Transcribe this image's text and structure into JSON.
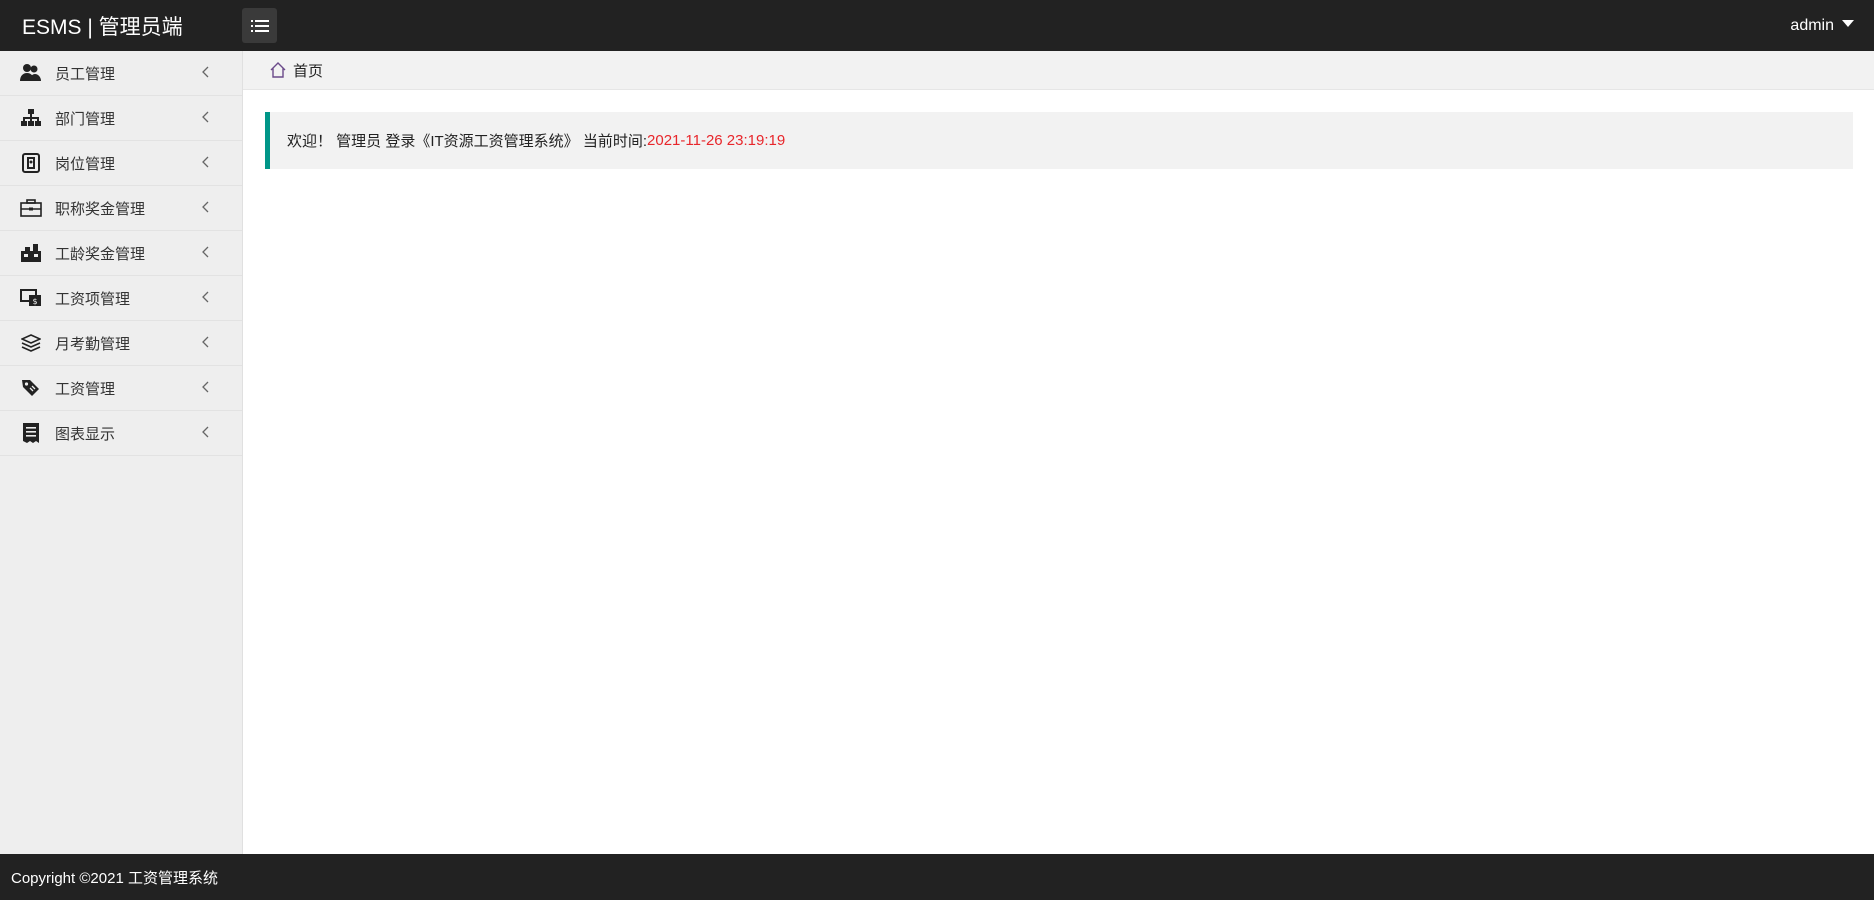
{
  "header": {
    "brand": "ESMS | 管理员端",
    "user": "admin"
  },
  "sidebar": {
    "items": [
      {
        "label": "员工管理",
        "icon": "users-icon"
      },
      {
        "label": "部门管理",
        "icon": "sitemap-icon"
      },
      {
        "label": "岗位管理",
        "icon": "badge-icon"
      },
      {
        "label": "职称奖金管理",
        "icon": "briefcase-icon"
      },
      {
        "label": "工龄奖金管理",
        "icon": "toolbox-icon"
      },
      {
        "label": "工资项管理",
        "icon": "money-screen-icon"
      },
      {
        "label": "月考勤管理",
        "icon": "layers-icon"
      },
      {
        "label": "工资管理",
        "icon": "tag-icon"
      },
      {
        "label": "图表显示",
        "icon": "receipt-icon"
      }
    ]
  },
  "breadcrumb": {
    "home": "首页"
  },
  "welcome": {
    "text": "欢迎！ 管理员 登录《IT资源工资管理系统》 当前时间:",
    "time": "2021-11-26 23:19:19"
  },
  "footer": {
    "copyright": "Copyright ©2021 工资管理系统"
  },
  "colors": {
    "topbar": "#222222",
    "sidebar": "#eeeeee",
    "accent": "#009688",
    "time": "#e8262b"
  }
}
